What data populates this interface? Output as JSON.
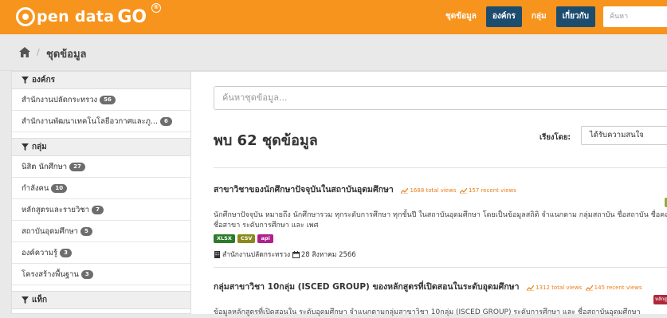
{
  "brand": {
    "logo_text": "pen data",
    "logo_go": "GO",
    "accent": "#f7941d",
    "nav_active": "#1d4d6e"
  },
  "nav": {
    "items": [
      {
        "label": "ชุดข้อมูล",
        "active": false
      },
      {
        "label": "องค์กร",
        "active": true
      },
      {
        "label": "กลุ่ม",
        "active": false
      },
      {
        "label": "เกี่ยวกับ",
        "active": true
      }
    ],
    "search_placeholder": "ค้นหา"
  },
  "breadcrumb": {
    "home_icon": "home-icon",
    "current": "ชุดข้อมูล"
  },
  "sidebar": {
    "org_heading": "องค์กร",
    "orgs": [
      {
        "label": "สำนักงานปลัดกระทรวง",
        "count": "56"
      },
      {
        "label": "สำนักงานพัฒนาเทคโนโลยีอวกาศและภู...",
        "count": "6"
      }
    ],
    "group_heading": "กลุ่ม",
    "groups": [
      {
        "label": "นิสิต นักศึกษา",
        "count": "27"
      },
      {
        "label": "กำลังคน",
        "count": "10"
      },
      {
        "label": "หลักสูตรและรายวิชา",
        "count": "7"
      },
      {
        "label": "สถาบันอุดมศึกษา",
        "count": "5"
      },
      {
        "label": "องค์ความรู้",
        "count": "3"
      },
      {
        "label": "โครงสร้างพื้นฐาน",
        "count": "3"
      }
    ],
    "tag_heading": "แท็ก"
  },
  "main": {
    "search_placeholder": "ค้นหาชุดข้อมูล...",
    "result_count": "พบ 62 ชุดข้อมูล",
    "sort_label": "เรียงโดย:",
    "sort_value": "ได้รับความสนใจ",
    "datasets": [
      {
        "title": "สาขาวิชาของนักศึกษาปัจจุบันในสถาบันอุดมศึกษา",
        "total_views": "1688 total views",
        "recent_views": "157 recent views",
        "description": "นักศึกษาปัจจุบัน หมายถึง นักศึกษารวม ทุกระดับการศึกษา ทุกชั้นปี ในสถาบันอุดมศึกษา โดยเป็นข้อมูลสถิติ จำแนกตาม กลุ่มสถาบัน ชื่อสถาบัน ชื่อคณะ ชื่อสาขา ระดับการศึกษา และ เพศ",
        "formats": [
          "XLSX",
          "CSV",
          "api"
        ],
        "org": "สำนักงานปลัดกระทรวง",
        "date": "28 สิงหาคม 2566"
      },
      {
        "title": "กลุ่มสาขาวิชา 10กลุ่ม (ISCED GROUP) ของหลักสูตรที่เปิดสอนในระดับอุดมศึกษา",
        "total_views": "1312 total views",
        "recent_views": "145 recent views",
        "description": "ข้อมูลหลักสูตรที่เปิดสอนใน ระดับอุดมศึกษา จำแนกตามกลุ่มสาขาวิชา 10กลุ่ม (ISCED GROUP) ระดับการศึกษา และ ชื่อสถาบันอุดมศึกษา",
        "side_tag": "หลักสู"
      }
    ]
  }
}
